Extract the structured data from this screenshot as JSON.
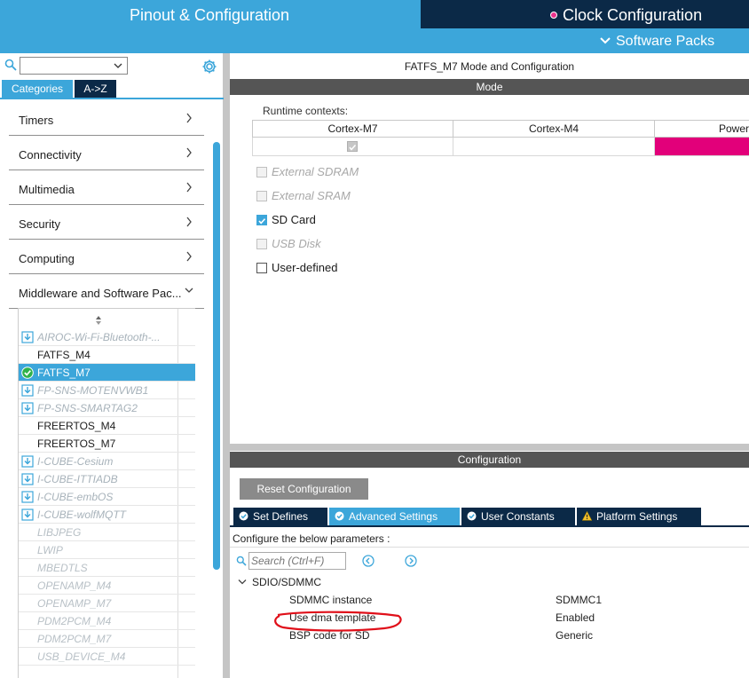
{
  "header": {
    "pinout_tab": "Pinout & Configuration",
    "clock_tab": "Clock Configuration",
    "software_packs": "Software Packs"
  },
  "left": {
    "search_value": "",
    "tabs": {
      "categories": "Categories",
      "az": "A->Z"
    },
    "categories": [
      {
        "label": "Timers",
        "expanded": false
      },
      {
        "label": "Connectivity",
        "expanded": false
      },
      {
        "label": "Multimedia",
        "expanded": false
      },
      {
        "label": "Security",
        "expanded": false
      },
      {
        "label": "Computing",
        "expanded": false
      },
      {
        "label": "Middleware and Software Pac...",
        "expanded": true
      }
    ],
    "middleware": [
      {
        "label": "AIROC-Wi-Fi-Bluetooth-...",
        "state": "pack",
        "icon": "download-icon"
      },
      {
        "label": "FATFS_M4",
        "state": "normal",
        "icon": ""
      },
      {
        "label": "FATFS_M7",
        "state": "selected",
        "icon": "check-circle-icon"
      },
      {
        "label": "FP-SNS-MOTENVWB1",
        "state": "pack",
        "icon": "download-icon"
      },
      {
        "label": "FP-SNS-SMARTAG2",
        "state": "pack",
        "icon": "download-icon"
      },
      {
        "label": "FREERTOS_M4",
        "state": "normal",
        "icon": ""
      },
      {
        "label": "FREERTOS_M7",
        "state": "normal",
        "icon": ""
      },
      {
        "label": "I-CUBE-Cesium",
        "state": "pack",
        "icon": "download-icon"
      },
      {
        "label": "I-CUBE-ITTIADB",
        "state": "pack",
        "icon": "download-icon"
      },
      {
        "label": "I-CUBE-embOS",
        "state": "pack",
        "icon": "download-icon"
      },
      {
        "label": "I-CUBE-wolfMQTT",
        "state": "pack",
        "icon": "download-icon"
      },
      {
        "label": "LIBJPEG",
        "state": "dim",
        "icon": ""
      },
      {
        "label": "LWIP",
        "state": "dim",
        "icon": ""
      },
      {
        "label": "MBEDTLS",
        "state": "dim",
        "icon": ""
      },
      {
        "label": "OPENAMP_M4",
        "state": "dim",
        "icon": ""
      },
      {
        "label": "OPENAMP_M7",
        "state": "dim",
        "icon": ""
      },
      {
        "label": "PDM2PCM_M4",
        "state": "dim",
        "icon": ""
      },
      {
        "label": "PDM2PCM_M7",
        "state": "dim",
        "icon": ""
      },
      {
        "label": "USB_DEVICE_M4",
        "state": "dim",
        "icon": ""
      }
    ]
  },
  "mode": {
    "title": "FATFS_M7 Mode and Configuration",
    "section": "Mode",
    "runtime_label": "Runtime contexts:",
    "contexts": [
      "Cortex-M7",
      "Cortex-M4",
      "Power"
    ],
    "options": [
      {
        "label": "External SDRAM",
        "checked": false,
        "disabled": true
      },
      {
        "label": "External SRAM",
        "checked": false,
        "disabled": true
      },
      {
        "label": "SD Card",
        "checked": true,
        "disabled": false
      },
      {
        "label": "USB Disk",
        "checked": false,
        "disabled": true
      },
      {
        "label": "User-defined",
        "checked": false,
        "disabled": false
      }
    ]
  },
  "config": {
    "section": "Configuration",
    "reset_button": "Reset Configuration",
    "tabs": [
      {
        "label": "Set Defines",
        "icon": "check-circle-icon",
        "active": false
      },
      {
        "label": "Advanced Settings",
        "icon": "check-circle-icon",
        "active": true
      },
      {
        "label": "User Constants",
        "icon": "check-circle-icon",
        "active": false
      },
      {
        "label": "Platform Settings",
        "icon": "warning-icon",
        "active": false
      }
    ],
    "hint": "Configure the below parameters :",
    "search_placeholder": "Search (Ctrl+F)",
    "group": "SDIO/SDMMC",
    "params": [
      {
        "name": "SDMMC instance",
        "value": "SDMMC1"
      },
      {
        "name": "Use dma template",
        "value": "Enabled"
      },
      {
        "name": "BSP code for SD",
        "value": "Generic"
      }
    ]
  },
  "colors": {
    "accent": "#3ca6da",
    "dark_navy": "#0b2947",
    "power_magenta": "#e2007a",
    "annotation_red": "#e0101a"
  }
}
